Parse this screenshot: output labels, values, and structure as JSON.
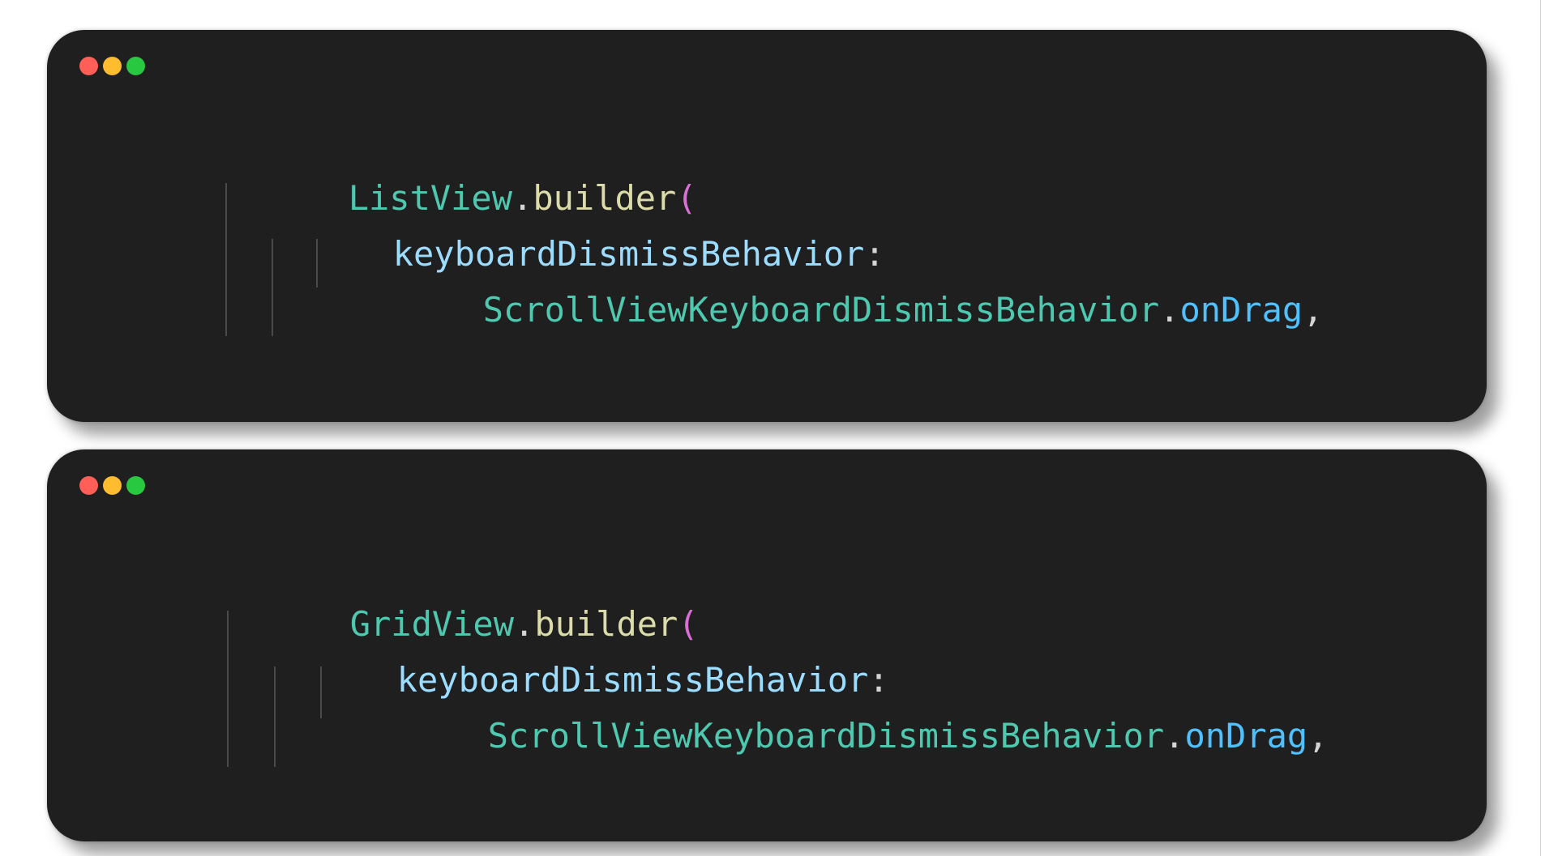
{
  "cards": [
    {
      "line1": {
        "type": "ListView",
        "dot": ".",
        "method": "builder",
        "paren": "("
      },
      "line2": {
        "param": "keyboardDismissBehavior",
        "colon": ":"
      },
      "line3": {
        "type": "ScrollViewKeyboardDismissBehavior",
        "dot": ".",
        "prop": "onDrag",
        "comma": ","
      }
    },
    {
      "line1": {
        "type": "GridView",
        "dot": ".",
        "method": "builder",
        "paren": "("
      },
      "line2": {
        "param": "keyboardDismissBehavior",
        "colon": ":"
      },
      "line3": {
        "type": "ScrollViewKeyboardDismissBehavior",
        "dot": ".",
        "prop": "onDrag",
        "comma": ","
      }
    }
  ],
  "window_controls": [
    "close-dot",
    "minimize-dot",
    "maximize-dot"
  ],
  "colors": {
    "background": "#ffffff",
    "card": "#1f1f1f",
    "close": "#ff5f57",
    "minimize": "#febc2e",
    "maximize": "#28c840",
    "type": "#4ec9b0",
    "method": "#dcdcaa",
    "paren": "#da70d6",
    "param": "#9cdcfe",
    "property": "#4fc1ff",
    "plain": "#d4d4d4"
  }
}
